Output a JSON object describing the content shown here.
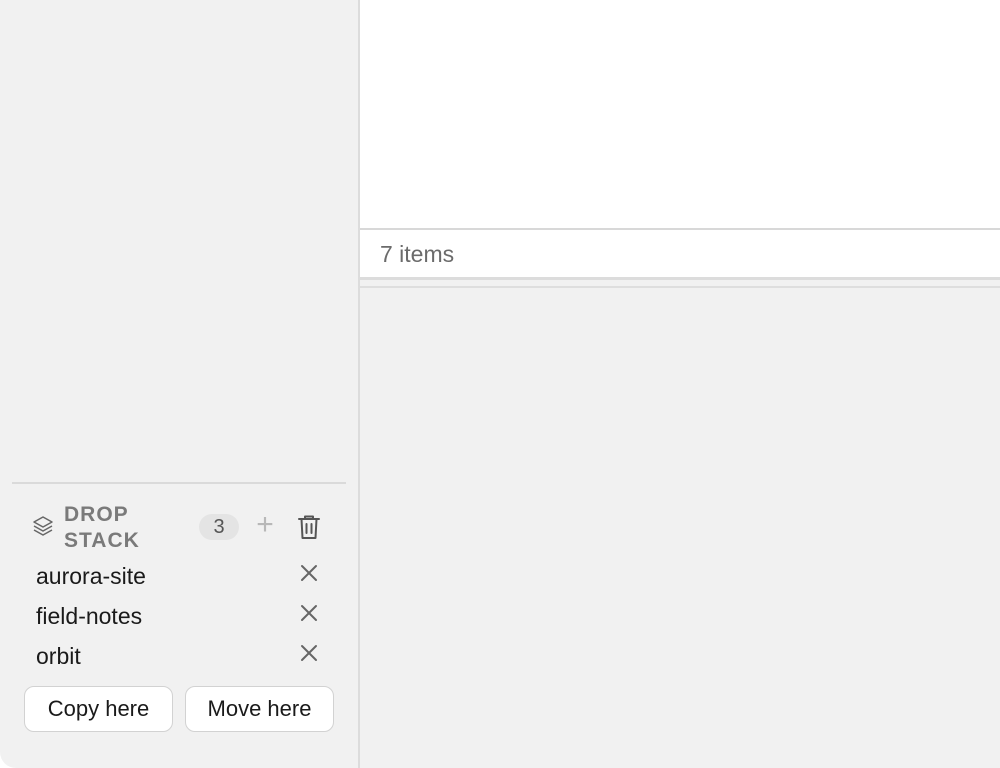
{
  "drop_stack": {
    "title": "DROP STACK",
    "count": "3",
    "add_glyph": "+",
    "items": [
      {
        "label": "aurora-site"
      },
      {
        "label": "field-notes"
      },
      {
        "label": "orbit"
      }
    ],
    "copy_label": "Copy here",
    "move_label": "Move here",
    "icons": {
      "stack": "layers-icon",
      "add": "plus-icon",
      "clear": "trash-icon",
      "remove": "close-icon"
    }
  },
  "status_bar": {
    "item_count": "7 items"
  },
  "colors": {
    "sidebar_bg": "#f1f1f1",
    "pane_bg": "#ffffff",
    "muted_text": "#7a7a7a"
  }
}
